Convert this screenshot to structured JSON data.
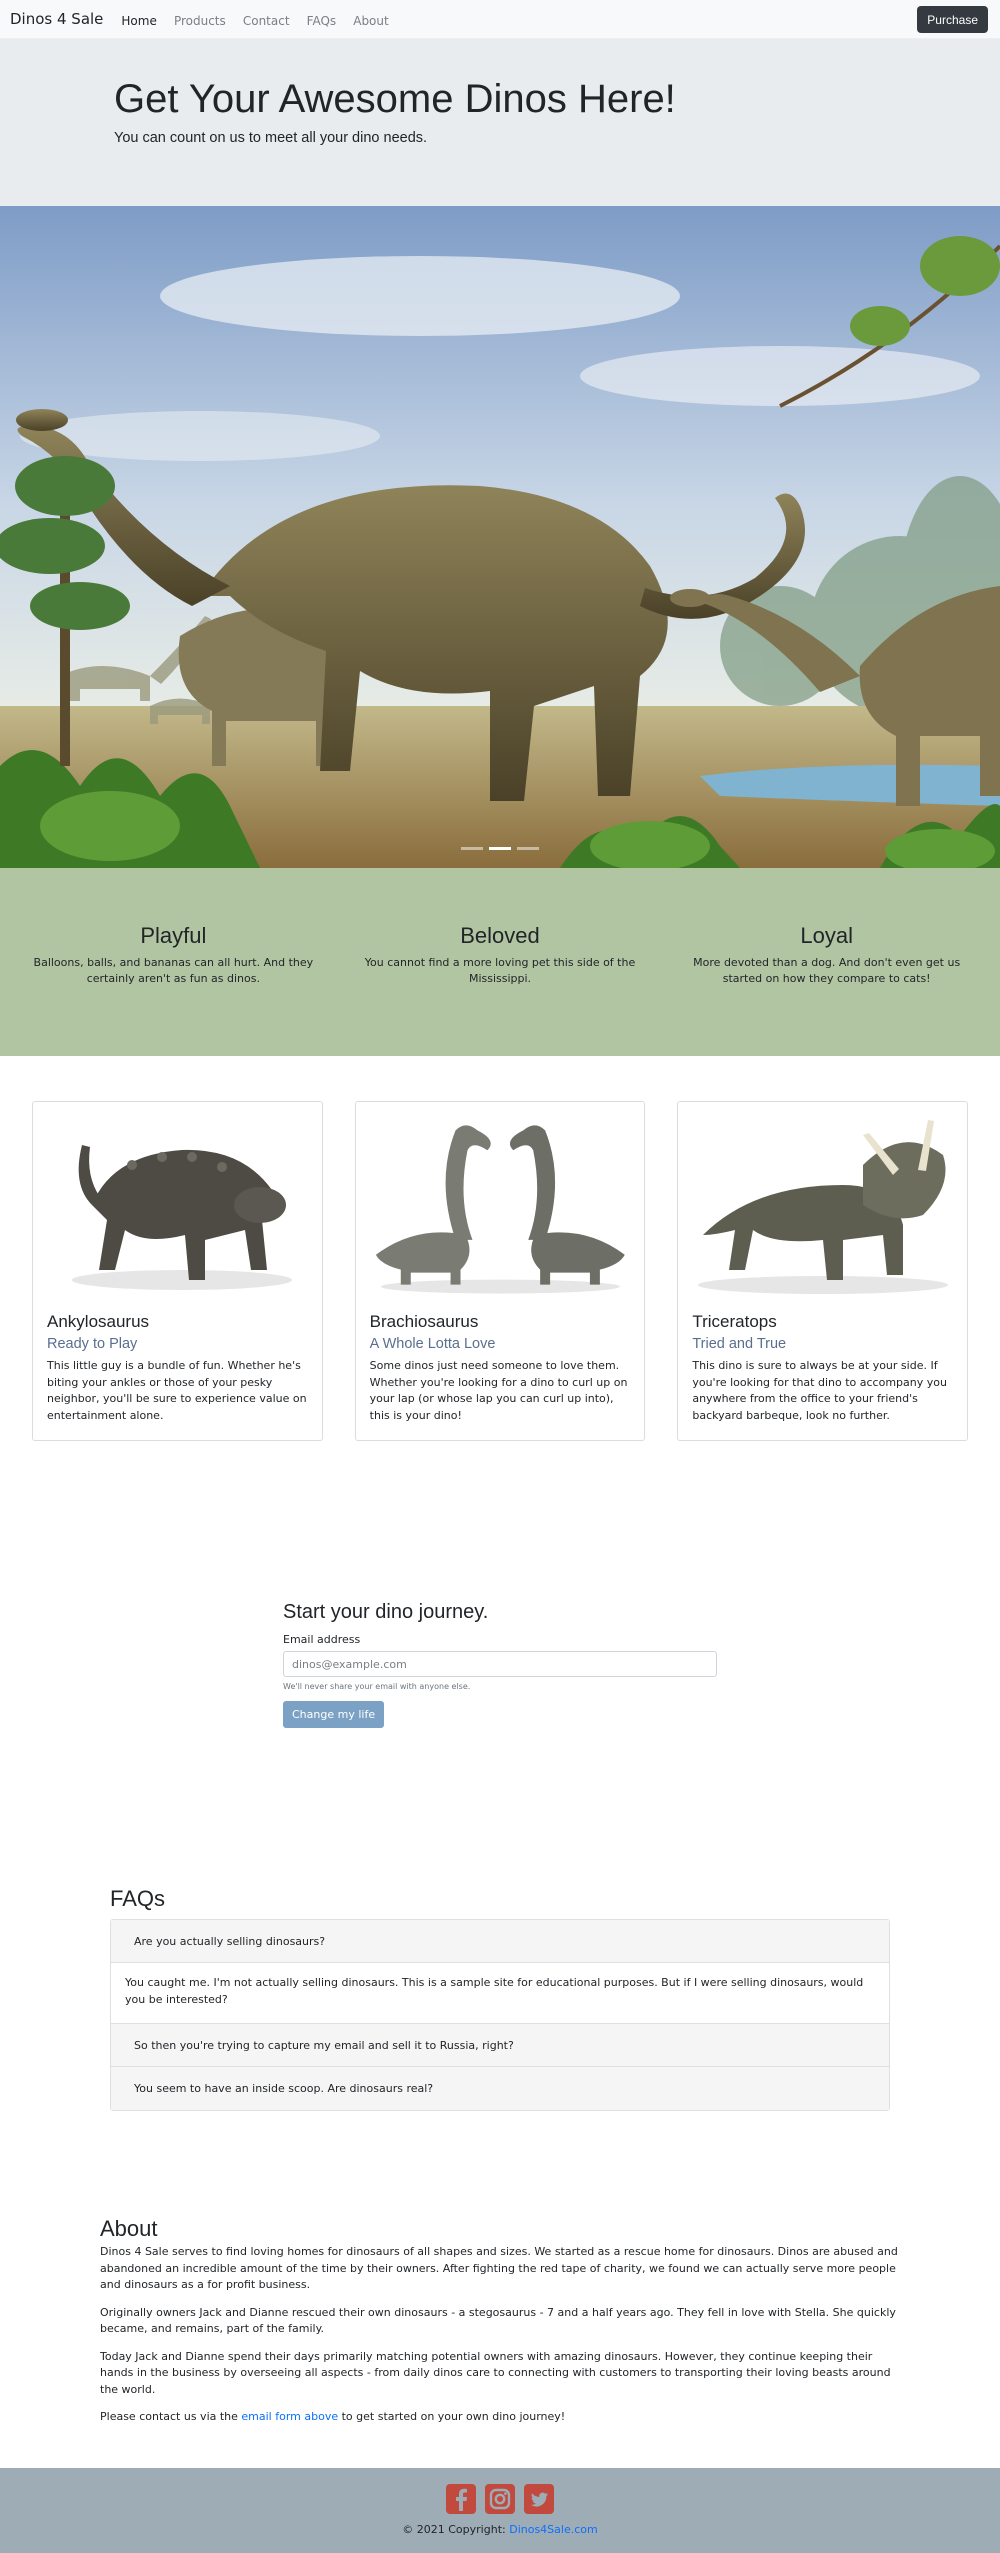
{
  "nav": {
    "brand": "Dinos 4 Sale",
    "links": [
      "Home",
      "Products",
      "Contact",
      "FAQs",
      "About"
    ],
    "purchase": "Purchase"
  },
  "jumbotron": {
    "title": "Get Your Awesome Dinos Here!",
    "lead": "You can count on us to meet all your dino needs."
  },
  "features": [
    {
      "title": "Playful",
      "text": "Balloons, balls, and bananas can all hurt. And they certainly aren't as fun as dinos."
    },
    {
      "title": "Beloved",
      "text": "You cannot find a more loving pet this side of the Mississippi."
    },
    {
      "title": "Loyal",
      "text": "More devoted than a dog. And don't even get us started on how they compare to cats!"
    }
  ],
  "cards": [
    {
      "title": "Ankylosaurus",
      "subtitle": "Ready to Play",
      "text": "This little guy is a bundle of fun. Whether he's biting your ankles or those of your pesky neighbor, you'll be sure to experience value on entertainment alone."
    },
    {
      "title": "Brachiosaurus",
      "subtitle": "A Whole Lotta Love",
      "text": "Some dinos just need someone to love them. Whether you're looking for a dino to curl up on your lap (or whose lap you can curl up into), this is your dino!"
    },
    {
      "title": "Triceratops",
      "subtitle": "Tried and True",
      "text": "This dino is sure to always be at your side. If you're looking for that dino to accompany you anywhere from the office to your friend's backyard barbeque, look no further."
    }
  ],
  "signup": {
    "heading": "Start your dino journey.",
    "label": "Email address",
    "placeholder": "dinos@example.com",
    "help": "We'll never share your email with anyone else.",
    "button": "Change my life"
  },
  "faqs": {
    "heading": "FAQs",
    "q1": "Are you actually selling dinosaurs?",
    "a1": "You caught me. I'm not actually selling dinosaurs. This is a sample site for educational purposes. But if I were selling dinosaurs, would you be interested?",
    "q2": "So then you're trying to capture my email and sell it to Russia, right?",
    "q3": "You seem to have an inside scoop. Are dinosaurs real?"
  },
  "about": {
    "heading": "About",
    "p1": "Dinos 4 Sale serves to find loving homes for dinosaurs of all shapes and sizes. We started as a rescue home for dinosaurs. Dinos are abused and abandoned an incredible amount of the time by their owners. After fighting the red tape of charity, we found we can actually serve more people and dinosaurs as a for profit business.",
    "p2": "Originally owners Jack and Dianne rescued their own dinosaurs - a stegosaurus - 7 and a half years ago. They fell in love with Stella. She quickly became, and remains, part of the family.",
    "p3": "Today Jack and Dianne spend their days primarily matching potential owners with amazing dinosaurs. However, they continue keeping their hands in the business by overseeing all aspects - from daily dinos care to connecting with customers to transporting their loving beasts around the world.",
    "p4_pre": "Please contact us via the ",
    "p4_link": "email form above",
    "p4_post": " to get started on your own dino journey!"
  },
  "footer": {
    "icons": [
      "facebook-icon",
      "instagram-icon",
      "twitter-icon"
    ],
    "copy": "© 2021 Copyright: ",
    "link": "Dinos4Sale.com"
  },
  "colors": {
    "features_bg": "#b2c5a2",
    "footer_bg": "#9eadb5",
    "social_icon": "#c1493e",
    "button": "#7ba2c5"
  }
}
